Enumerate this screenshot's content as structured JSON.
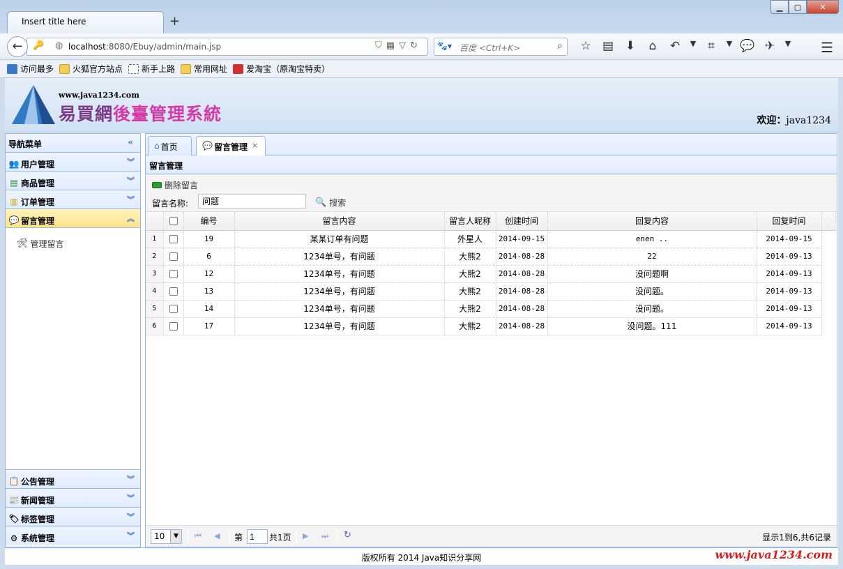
{
  "browser": {
    "tab_title": "Insert title here",
    "new_tab": "+",
    "url_host": "localhost",
    "url_rest": ":8080/Ebuy/admin/main.jsp",
    "search_placeholder": "百度 <Ctrl+K>",
    "bookmarks": [
      {
        "label": "访问最多",
        "icon": "blue"
      },
      {
        "label": "火狐官方站点",
        "icon": "folder"
      },
      {
        "label": "新手上路",
        "icon": "dash"
      },
      {
        "label": "常用网址",
        "icon": "folder"
      },
      {
        "label": "爱淘宝（原淘宝特卖）",
        "icon": "red"
      }
    ]
  },
  "header": {
    "site_url": "www.java1234.com",
    "title_part1": "易買網",
    "title_part2": "後臺管理系統",
    "welcome_label": "欢迎：",
    "username": "java1234"
  },
  "sidebar": {
    "title": "导航菜单",
    "top_items": [
      {
        "label": "用户管理",
        "icon": "👥"
      },
      {
        "label": "商品管理",
        "icon": "▤"
      },
      {
        "label": "订单管理",
        "icon": "▥"
      }
    ],
    "active_item": {
      "label": "留言管理",
      "icon": "💬"
    },
    "active_links": [
      {
        "label": "管理留言"
      }
    ],
    "bottom_items": [
      {
        "label": "公告管理",
        "icon": "📋"
      },
      {
        "label": "新闻管理",
        "icon": "📰"
      },
      {
        "label": "标签管理",
        "icon": "🏷"
      },
      {
        "label": "系统管理",
        "icon": "⚙"
      }
    ]
  },
  "main": {
    "tabs": [
      {
        "label": "首页"
      },
      {
        "label": "留言管理",
        "close": "×"
      }
    ],
    "panel_title": "留言管理",
    "delete_label": "删除留言",
    "search_label": "留言名称:",
    "search_value": "问题",
    "search_button": "搜索",
    "columns": [
      "编号",
      "留言内容",
      "留言人昵称",
      "创建时间",
      "回复内容",
      "回复时间"
    ],
    "rows": [
      {
        "rn": "1",
        "id": "19",
        "content": "某某订单有问题",
        "nick": "外星人",
        "created": "2014-09-15",
        "reply": "enen ..",
        "reply_time": "2014-09-15"
      },
      {
        "rn": "2",
        "id": "6",
        "content": "1234单号，有问题",
        "nick": "大熊2",
        "created": "2014-08-28",
        "reply": "22",
        "reply_time": "2014-09-13"
      },
      {
        "rn": "3",
        "id": "12",
        "content": "1234单号，有问题",
        "nick": "大熊2",
        "created": "2014-08-28",
        "reply": "没问题啊",
        "reply_time": "2014-09-13"
      },
      {
        "rn": "4",
        "id": "13",
        "content": "1234单号，有问题",
        "nick": "大熊2",
        "created": "2014-08-28",
        "reply": "没问题。",
        "reply_time": "2014-09-13"
      },
      {
        "rn": "5",
        "id": "14",
        "content": "1234单号，有问题",
        "nick": "大熊2",
        "created": "2014-08-28",
        "reply": "没问题。",
        "reply_time": "2014-09-13"
      },
      {
        "rn": "6",
        "id": "17",
        "content": "1234单号，有问题",
        "nick": "大熊2",
        "created": "2014-08-28",
        "reply": "没问题。111",
        "reply_time": "2014-09-13"
      }
    ],
    "pager": {
      "page_size": "10",
      "page_prefix": "第",
      "page_value": "1",
      "page_total": "共1页",
      "info": "显示1到6,共6记录"
    }
  },
  "footer": {
    "copyright": "版权所有 2014 Java知识分享网",
    "brand": "www.java1234.com"
  }
}
